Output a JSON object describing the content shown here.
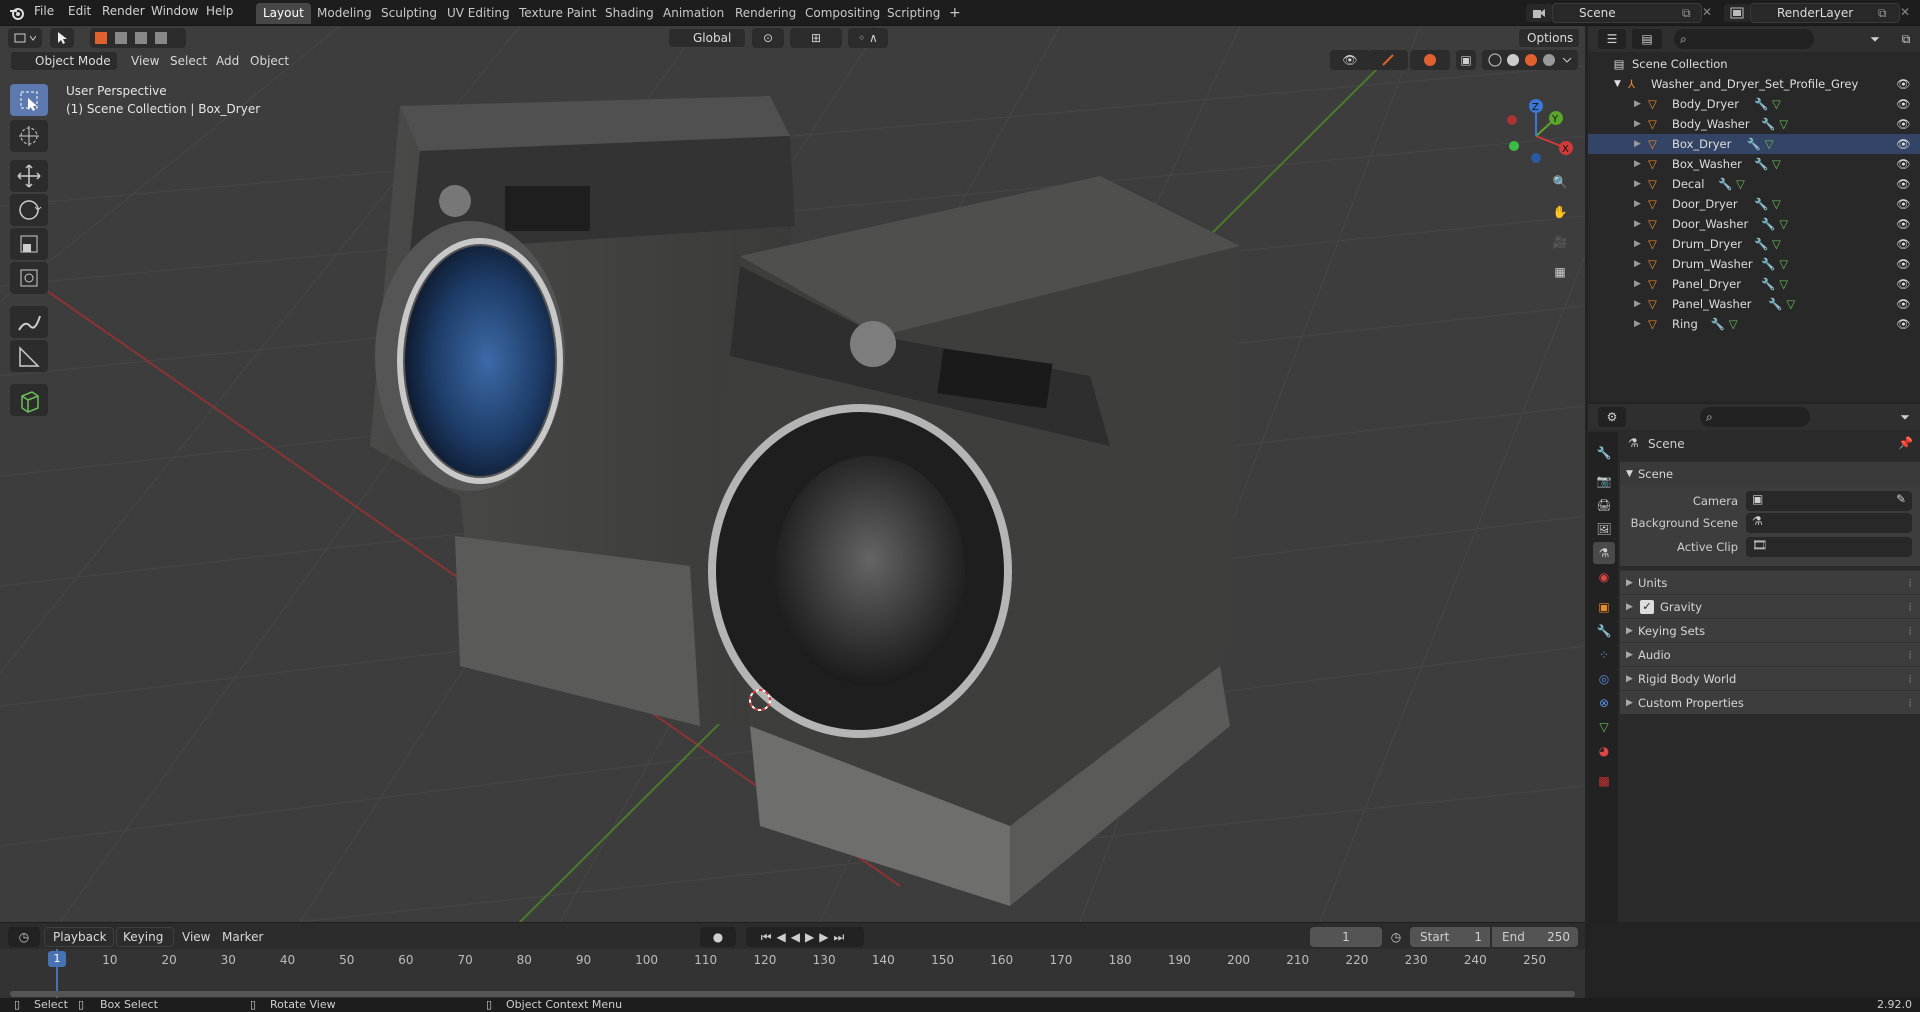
{
  "topbar": {
    "menus": [
      "File",
      "Edit",
      "Render",
      "Window",
      "Help"
    ],
    "workspaces": [
      "Layout",
      "Modeling",
      "Sculpting",
      "UV Editing",
      "Texture Paint",
      "Shading",
      "Animation",
      "Rendering",
      "Compositing",
      "Scripting"
    ],
    "active_workspace": "Layout",
    "add_tab": "+",
    "scene": "Scene",
    "view_layer": "RenderLayer"
  },
  "viewport": {
    "mode": "Object Mode",
    "menus": [
      "View",
      "Select",
      "Add",
      "Object"
    ],
    "orientation": "Global",
    "options": "Options",
    "perspective": "User Perspective",
    "collection_label": "(1) Scene Collection | Box_Dryer",
    "gizmo": {
      "x": "X",
      "y": "Y",
      "z": "Z"
    }
  },
  "outliner": {
    "root": "Scene Collection",
    "collection": "Washer_and_Dryer_Set_Profile_Grey",
    "objects": [
      "Body_Dryer",
      "Body_Washer",
      "Box_Dryer",
      "Box_Washer",
      "Decal",
      "Door_Dryer",
      "Door_Washer",
      "Drum_Dryer",
      "Drum_Washer",
      "Panel_Dryer",
      "Panel_Washer",
      "Ring"
    ]
  },
  "properties": {
    "context": "Scene",
    "section": "Scene",
    "camera_label": "Camera",
    "background_label": "Background Scene",
    "clip_label": "Active Clip",
    "panels": [
      "Units",
      "Gravity",
      "Keying Sets",
      "Audio",
      "Rigid Body World",
      "Custom Properties"
    ],
    "gravity_checked": true
  },
  "timeline": {
    "menus": [
      "Playback",
      "Keying",
      "View",
      "Marker"
    ],
    "current_frame": "1",
    "start_label": "Start",
    "start": "1",
    "end_label": "End",
    "end": "250",
    "ruler": [
      "1",
      "10",
      "20",
      "30",
      "40",
      "50",
      "60",
      "70",
      "80",
      "90",
      "100",
      "110",
      "120",
      "130",
      "140",
      "150",
      "160",
      "170",
      "180",
      "190",
      "200",
      "210",
      "220",
      "230",
      "240",
      "250"
    ]
  },
  "statusbar": {
    "select": "Select",
    "box_select": "Box Select",
    "rotate": "Rotate View",
    "context_menu": "Object Context Menu",
    "version": "2.92.0"
  },
  "colors": {
    "accent": "#4772b3",
    "orange": "#e8892b",
    "x_axis": "#d03a3a",
    "y_axis": "#5aa52a",
    "z_axis": "#3a77d6"
  }
}
